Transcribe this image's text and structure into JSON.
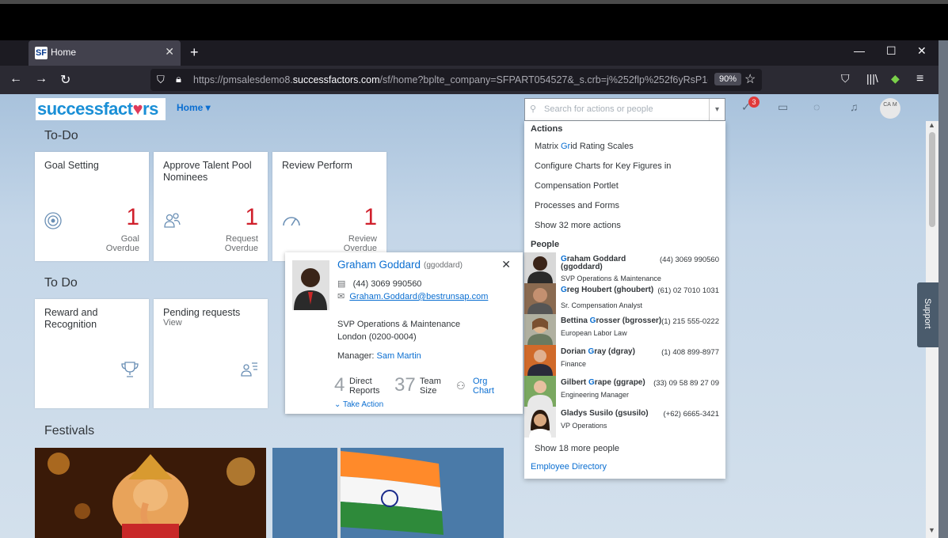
{
  "browser": {
    "tab_title": "Home",
    "tab_favicon": "SF",
    "url_prefix": "https://pmsalesdemo8.",
    "url_domain": "successfactors.com",
    "url_suffix": "/sf/home?bplte_company=SFPART054527&_s.crb=j%252flp%252f6yRsP1ctMq",
    "zoom": "90%"
  },
  "header": {
    "logo_a": "successfact",
    "logo_b": "rs",
    "home_label": "Home ▾",
    "search_placeholder": "Search for actions or people",
    "notif_count": "3",
    "avatar_text": "CA M"
  },
  "sections": {
    "todo1": "To-Do",
    "todo2": "To Do",
    "festivals": "Festivals"
  },
  "tiles": [
    {
      "title": "Goal Setting",
      "num": "1",
      "label1": "Goal",
      "label2": "Overdue"
    },
    {
      "title": "Approve Talent Pool Nominees",
      "num": "1",
      "label1": "Request",
      "label2": "Overdue"
    },
    {
      "title": "Review Perform",
      "num": "1",
      "label1": "Review",
      "label2": "Overdue"
    },
    {
      "title": "Reward and Recognition"
    },
    {
      "title": "Pending requests",
      "sub": "View"
    }
  ],
  "dropdown": {
    "actions_h": "Actions",
    "actions": [
      "Configure Charts for Key Figures in",
      "Compensation Portlet",
      "Processes and Forms",
      "Show 32 more actions"
    ],
    "action1_a": "Matrix ",
    "action1_b": "Gr",
    "action1_c": "id Rating Scales",
    "people_h": "People",
    "people": [
      {
        "a": "",
        "b": "G",
        "c": "raham Goddard (ggoddard)",
        "title": "SVP Operations & Maintenance",
        "phone": "(44) 3069 990560"
      },
      {
        "a": "",
        "b": "G",
        "c": "reg Houbert (ghoubert)",
        "title": "Sr. Compensation Analyst",
        "phone": "(61) 02 7010 1031"
      },
      {
        "a": "Bettina ",
        "b": "G",
        "c": "rosser (bgrosser)",
        "title": "European Labor Law",
        "phone": "(1) 215 555-0222"
      },
      {
        "a": "Dorian ",
        "b": "G",
        "c": "ray (dgray)",
        "title": "Finance",
        "phone": "(1) 408 899-8977"
      },
      {
        "a": "Gilbert ",
        "b": "G",
        "c": "rape (ggrape)",
        "title": "Engineering Manager",
        "phone": "(33) 09 58 89 27 09"
      },
      {
        "a": "Gladys Susilo (gsusilo)",
        "b": "",
        "c": "",
        "title": "VP Operations",
        "phone": "(+62) 6665-3421"
      }
    ],
    "show_more_people": "Show 18 more people",
    "employee_directory": "Employee Directory"
  },
  "card": {
    "name": "Graham Goddard",
    "uid": "(ggoddard)",
    "phone": "(44) 3069 990560",
    "email": "Graham.Goddard@bestrunsap.com",
    "title": "SVP Operations & Maintenance",
    "location": "London (0200-0004)",
    "manager_label": "Manager:",
    "manager": "Sam Martin",
    "direct_count": "4",
    "direct_label1": "Direct",
    "direct_label2": "Reports",
    "team_count": "37",
    "team_label1": "Team",
    "team_label2": "Size",
    "org1": "Org",
    "org2": "Chart",
    "take_action": "Take Action"
  },
  "support": "Support"
}
